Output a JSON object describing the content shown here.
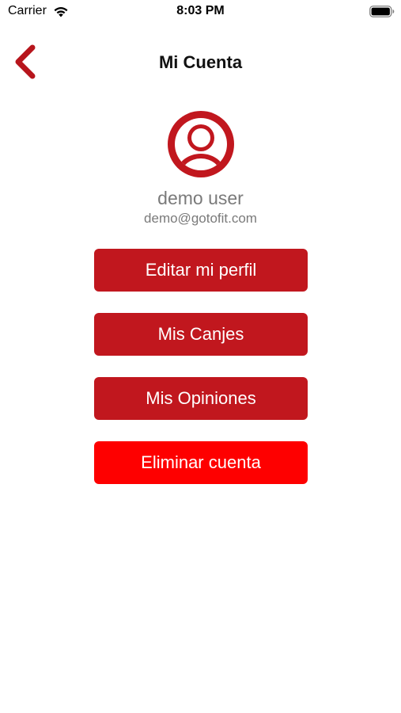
{
  "status_bar": {
    "carrier": "Carrier",
    "time": "8:03 PM",
    "wifi_icon": "wifi-icon",
    "battery_icon": "battery-icon"
  },
  "nav": {
    "title": "Mi Cuenta",
    "back_icon": "chevron-left-icon"
  },
  "profile": {
    "avatar_icon": "user-avatar-icon",
    "name": "demo user",
    "email": "demo@gotofit.com"
  },
  "actions": {
    "edit_profile": "Editar mi perfil",
    "my_redemptions": "Mis Canjes",
    "my_reviews": "Mis Opiniones",
    "delete_account": "Eliminar cuenta"
  },
  "colors": {
    "brand_red": "#c1171e",
    "danger_red": "#fe0000",
    "secondary_text": "#7a7a7a"
  }
}
